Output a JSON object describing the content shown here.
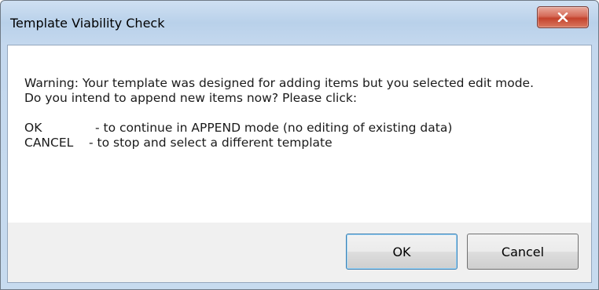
{
  "window": {
    "title": "Template Viability Check"
  },
  "message": {
    "line1": "Warning: Your template was designed for adding items but you selected edit mode.",
    "line2": "Do you intend to append new items now?  Please click:",
    "options": [
      {
        "key": "OK",
        "description": "- to continue in APPEND mode (no editing of existing data)"
      },
      {
        "key": "CANCEL",
        "description": "- to stop and select a different template"
      }
    ]
  },
  "buttons": {
    "ok_label": "OK",
    "cancel_label": "Cancel"
  },
  "icons": {
    "close": "close-icon"
  },
  "colors": {
    "titlebar": "#b9d1ea",
    "close_button": "#c4432d",
    "footer": "#f0f0f0"
  }
}
